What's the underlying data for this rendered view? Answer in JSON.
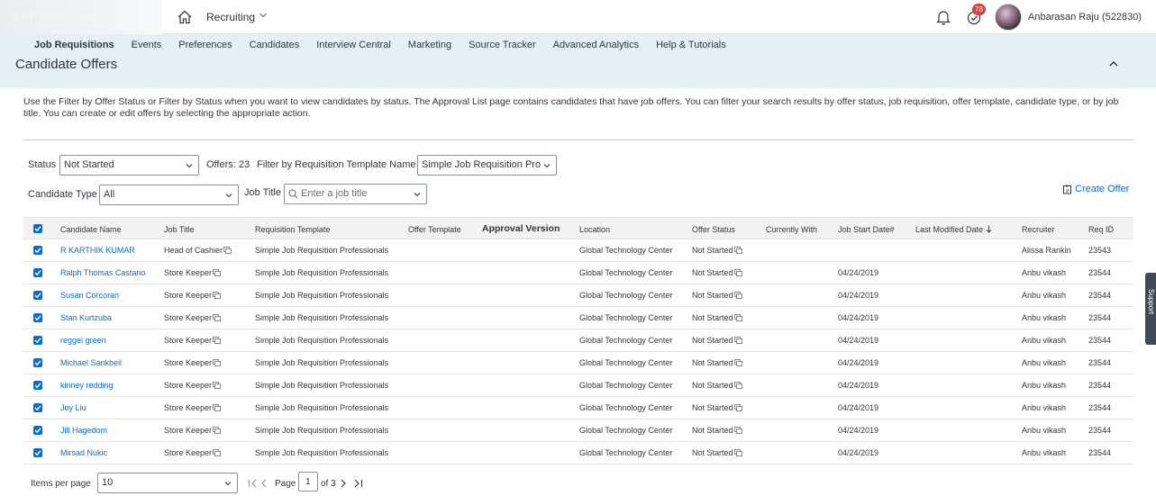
{
  "shell": {
    "logo_text": "SAP SuccessFactors",
    "module": "Recruiting",
    "todo_badge": "78",
    "user_name": "Anbarasan Raju (522830)"
  },
  "subnav": {
    "tabs": [
      "Job Requisitions",
      "Events",
      "Preferences",
      "Candidates",
      "Interview Central",
      "Marketing",
      "Source Tracker",
      "Advanced Analytics",
      "Help & Tutorials"
    ],
    "page_title": "Candidate Offers"
  },
  "description": "Use the Filter by Offer Status or Filter by Status when you want to view candidates by status. The Approval List page contains candidates that have job offers. You can filter your search results by offer status, job requisition, offer template, candidate type, or by job title. You can create or edit offers by selecting the appropriate action.",
  "filters": {
    "status_label": "Status",
    "status_value": "Not Started",
    "offers_count": "Offers: 23",
    "template_label": "Filter by Requisition Template Name",
    "template_value": "Simple Job Requisition Pro",
    "candidate_type_label": "Candidate Type",
    "candidate_type_value": "All",
    "job_title_label": "Job Title",
    "job_title_placeholder": "Enter a job title"
  },
  "create_offer": "Create Offer",
  "table": {
    "headers": {
      "candidate_name": "Candidate Name",
      "job_title": "Job Title",
      "requisition_template": "Requisition Template",
      "offer_template": "Offer Template",
      "approval_version": "Approval Version",
      "location": "Location",
      "offer_status": "Offer Status",
      "currently_with": "Currently With",
      "job_start_date": "Job Start Date#",
      "last_modified": "Last Modified Date",
      "recruiter": "Recruiter",
      "req_id": "Req ID"
    },
    "rows": [
      {
        "name": "R KARTHIK KUMAR",
        "job": "Head of Cashier",
        "template": "Simple Job Requisition Professionals",
        "location": "Global Technology Center",
        "status": "Not Started",
        "start": "",
        "recruiter": "Alissa Rankin",
        "req": "23543"
      },
      {
        "name": "Ralph Thomas Castano",
        "job": "Store Keeper",
        "template": "Simple Job Requisition Professionals",
        "location": "Global Technology Center",
        "status": "Not Started",
        "start": "04/24/2019",
        "recruiter": "Anbu vikash",
        "req": "23544"
      },
      {
        "name": "Susan Corcoran",
        "job": "Store Keeper",
        "template": "Simple Job Requisition Professionals",
        "location": "Global Technology Center",
        "status": "Not Started",
        "start": "04/24/2019",
        "recruiter": "Anbu vikash",
        "req": "23544"
      },
      {
        "name": "Stan Kurtzuba",
        "job": "Store Keeper",
        "template": "Simple Job Requisition Professionals",
        "location": "Global Technology Center",
        "status": "Not Started",
        "start": "04/24/2019",
        "recruiter": "Anbu vikash",
        "req": "23544"
      },
      {
        "name": "reggei green",
        "job": "Store Keeper",
        "template": "Simple Job Requisition Professionals",
        "location": "Global Technology Center",
        "status": "Not Started",
        "start": "04/24/2019",
        "recruiter": "Anbu vikash",
        "req": "23544"
      },
      {
        "name": "Michael Sankbeil",
        "job": "Store Keeper",
        "template": "Simple Job Requisition Professionals",
        "location": "Global Technology Center",
        "status": "Not Started",
        "start": "04/24/2019",
        "recruiter": "Anbu vikash",
        "req": "23544"
      },
      {
        "name": "kinney redding",
        "job": "Store Keeper",
        "template": "Simple Job Requisition Professionals",
        "location": "Global Technology Center",
        "status": "Not Started",
        "start": "04/24/2019",
        "recruiter": "Anbu vikash",
        "req": "23544"
      },
      {
        "name": "Joy Liu",
        "job": "Store Keeper",
        "template": "Simple Job Requisition Professionals",
        "location": "Global Technology Center",
        "status": "Not Started",
        "start": "04/24/2019",
        "recruiter": "Anbu vikash",
        "req": "23544"
      },
      {
        "name": "Jill Hagedom",
        "job": "Store Keeper",
        "template": "Simple Job Requisition Professionals",
        "location": "Global Technology Center",
        "status": "Not Started",
        "start": "04/24/2019",
        "recruiter": "Anbu vikash",
        "req": "23544"
      },
      {
        "name": "Mirsad Nukic",
        "job": "Store Keeper",
        "template": "Simple Job Requisition Professionals",
        "location": "Global Technology Center",
        "status": "Not Started",
        "start": "04/24/2019",
        "recruiter": "Anbu vikash",
        "req": "23544"
      }
    ]
  },
  "pager": {
    "items_label": "Items per page",
    "items_value": "10",
    "page_label": "Page",
    "page_value": "1",
    "of_label": "of 3"
  },
  "side_tab": "Support",
  "colors": {
    "accent": "#0a6ed1",
    "subnav_bg": "#e5f0f5",
    "badge": "#d04343"
  },
  "icons": [
    "home-icon",
    "chevron-down-icon",
    "bell-icon",
    "todo-icon",
    "collapse-icon",
    "search-icon",
    "create-offer-icon",
    "view-icon",
    "sort-down-icon",
    "first-page-icon",
    "prev-page-icon",
    "next-page-icon",
    "last-page-icon",
    "checkbox-icon"
  ]
}
